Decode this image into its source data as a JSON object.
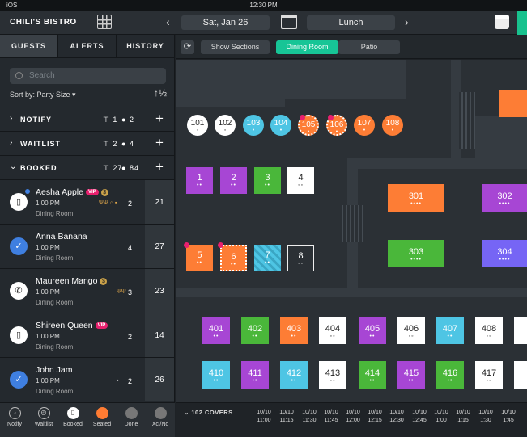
{
  "status": {
    "carrier": "iOS",
    "time": "12:30 PM"
  },
  "header": {
    "brand": "CHILI'S BISTRO",
    "date": "Sat, Jan 26",
    "shift": "Lunch",
    "prev": "‹",
    "next": "›"
  },
  "sidebar": {
    "tabs": [
      "GUESTS",
      "ALERTS",
      "HISTORY"
    ],
    "search_placeholder": "Search",
    "sort_label": "Sort by: Party Size ▾",
    "sort_icon": "↑½",
    "sections": [
      {
        "label": "NOTIFY",
        "tables": "1",
        "people": "2"
      },
      {
        "label": "WAITLIST",
        "tables": "2",
        "people": "4"
      },
      {
        "label": "BOOKED",
        "tables": "27",
        "people": "84"
      }
    ],
    "guests": [
      {
        "name": "Aesha Apple",
        "vip": "VIP",
        "time": "1:00 PM",
        "room": "Dining Room",
        "party": "2",
        "table": "21",
        "avatar": "book-icon"
      },
      {
        "name": "Anna Banana",
        "vip": "",
        "time": "1:00 PM",
        "room": "Dining Room",
        "party": "4",
        "table": "27",
        "avatar": "check-icon"
      },
      {
        "name": "Maureen Mango",
        "vip": "",
        "time": "1:00 PM",
        "room": "Dining Room",
        "party": "3",
        "table": "23",
        "avatar": "phone-icon"
      },
      {
        "name": "Shireen Queen",
        "vip": "VIP",
        "time": "1:00 PM",
        "room": "Dining Room",
        "party": "2",
        "table": "14",
        "avatar": "book-icon"
      },
      {
        "name": "John Jam",
        "vip": "",
        "time": "1:00 PM",
        "room": "Dining Room",
        "party": "2",
        "table": "26",
        "avatar": "check-icon"
      }
    ],
    "bottom": [
      "Notify",
      "Waitlist",
      "Booked",
      "Seated",
      "Done",
      "Xcl/No"
    ]
  },
  "toolbar": {
    "show_sections": "Show Sections",
    "rooms": [
      "Dining Room",
      "Patio"
    ]
  },
  "floor": {
    "round_tables": [
      "101",
      "102",
      "103",
      "104",
      "105",
      "106",
      "107",
      "108"
    ],
    "tables_a": [
      "1",
      "2",
      "3",
      "4",
      "5",
      "6",
      "7",
      "8"
    ],
    "tables_b": [
      "301",
      "302",
      "303",
      "304"
    ],
    "row_400": [
      "401",
      "402",
      "403",
      "404",
      "405",
      "406",
      "407",
      "408"
    ],
    "row_410": [
      "410",
      "411",
      "412",
      "413",
      "414",
      "415",
      "416",
      "417"
    ]
  },
  "timeline": {
    "covers": "102 COVERS",
    "counts": [
      "10/10",
      "10/10",
      "10/10",
      "10/10",
      "10/10",
      "10/10",
      "10/10",
      "10/10",
      "10/10",
      "10/10",
      "10/10",
      "10/10"
    ],
    "times": [
      "11:00",
      "11:15",
      "11:30",
      "11:45",
      "12:00",
      "12:15",
      "12:30",
      "12:45",
      "1:00",
      "1:15",
      "1:30",
      "1:45"
    ]
  },
  "colors": {
    "accent": "#17c596",
    "orange": "#fd7d35",
    "purple": "#a746d4",
    "green": "#4ab73a",
    "cyan": "#4ec5e4",
    "vip": "#e8206e"
  }
}
